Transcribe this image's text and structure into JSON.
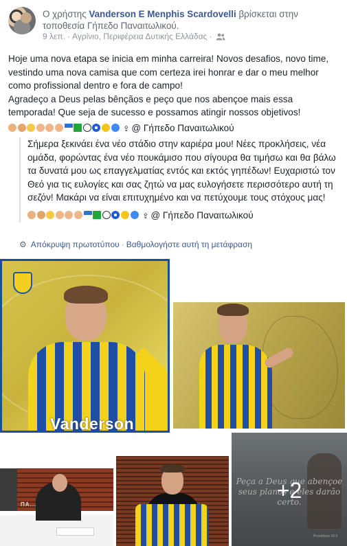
{
  "header": {
    "prefix": "Ο χρήστης ",
    "author": "Vanderson E Menphis Scardovelli",
    "middle": " βρίσκεται στην τοποθεσία ",
    "place": "Γήπεδο Παναιτωλικού",
    "suffix": ".",
    "meta": "9 λεπ. · Αγρίνιο, Περιφέρεια Δυτικής Ελλάδας · ",
    "audience_icon": "friends-icon"
  },
  "post": {
    "paragraph1": "Hoje uma nova etapa se inicia em minha carreira! Novos desafios, novo time, vestindo uma nova camisa que com certeza irei honrar e dar o meu melhor como profissional dentro e fora de campo!",
    "paragraph2": "Agradeço a Deus pelas bênçãos e peço que nos abençoe mais essa temporada! Que seja de sucesso e possamos atingir nossos objetivos!",
    "location_tag": "@ Γήπεδο Παναιτωλικού"
  },
  "translation": {
    "text": "Σήμερα ξεκινάει ένα νέο στάδιο στην καριέρα μου! Νέες προκλήσεις, νέα ομάδα, φορώντας ένα νέο πουκάμισο που σίγουρα θα τιμήσω και θα βάλω τα δυνατά μου ως επαγγελματίας εντός και εκτός γηπέδων! Ευχαριστώ τον Θεό για τις ευλογίες και σας ζητώ να μας ευλογήσετε περισσότερο αυτή τη σεζόν! Μακάρι να είναι επιτυχημένο και να πετύχουμε τους στόχους μας!",
    "location_tag": "@ Γήπεδο Παναιτωλικού",
    "hide_original": "Απόκρυψη πρωτοτύπου",
    "separator": "·",
    "rate": "Βαθμολογήστε αυτή τη μετάφραση"
  },
  "photos": {
    "photo1_label": "Vanderson",
    "photo3_text": "ΠΑ... ...ΚΟΣ",
    "photo5_quote": "Peça a Deus que abençoe seus planos e eles darão certo.",
    "photo5_ref": "Provérbios 16:3",
    "more_count": "+2"
  },
  "colors": {
    "link": "#385898",
    "text": "#1d2129",
    "meta": "#90949c",
    "jersey_yellow": "#f2d21a",
    "jersey_blue": "#1e4fa5"
  }
}
